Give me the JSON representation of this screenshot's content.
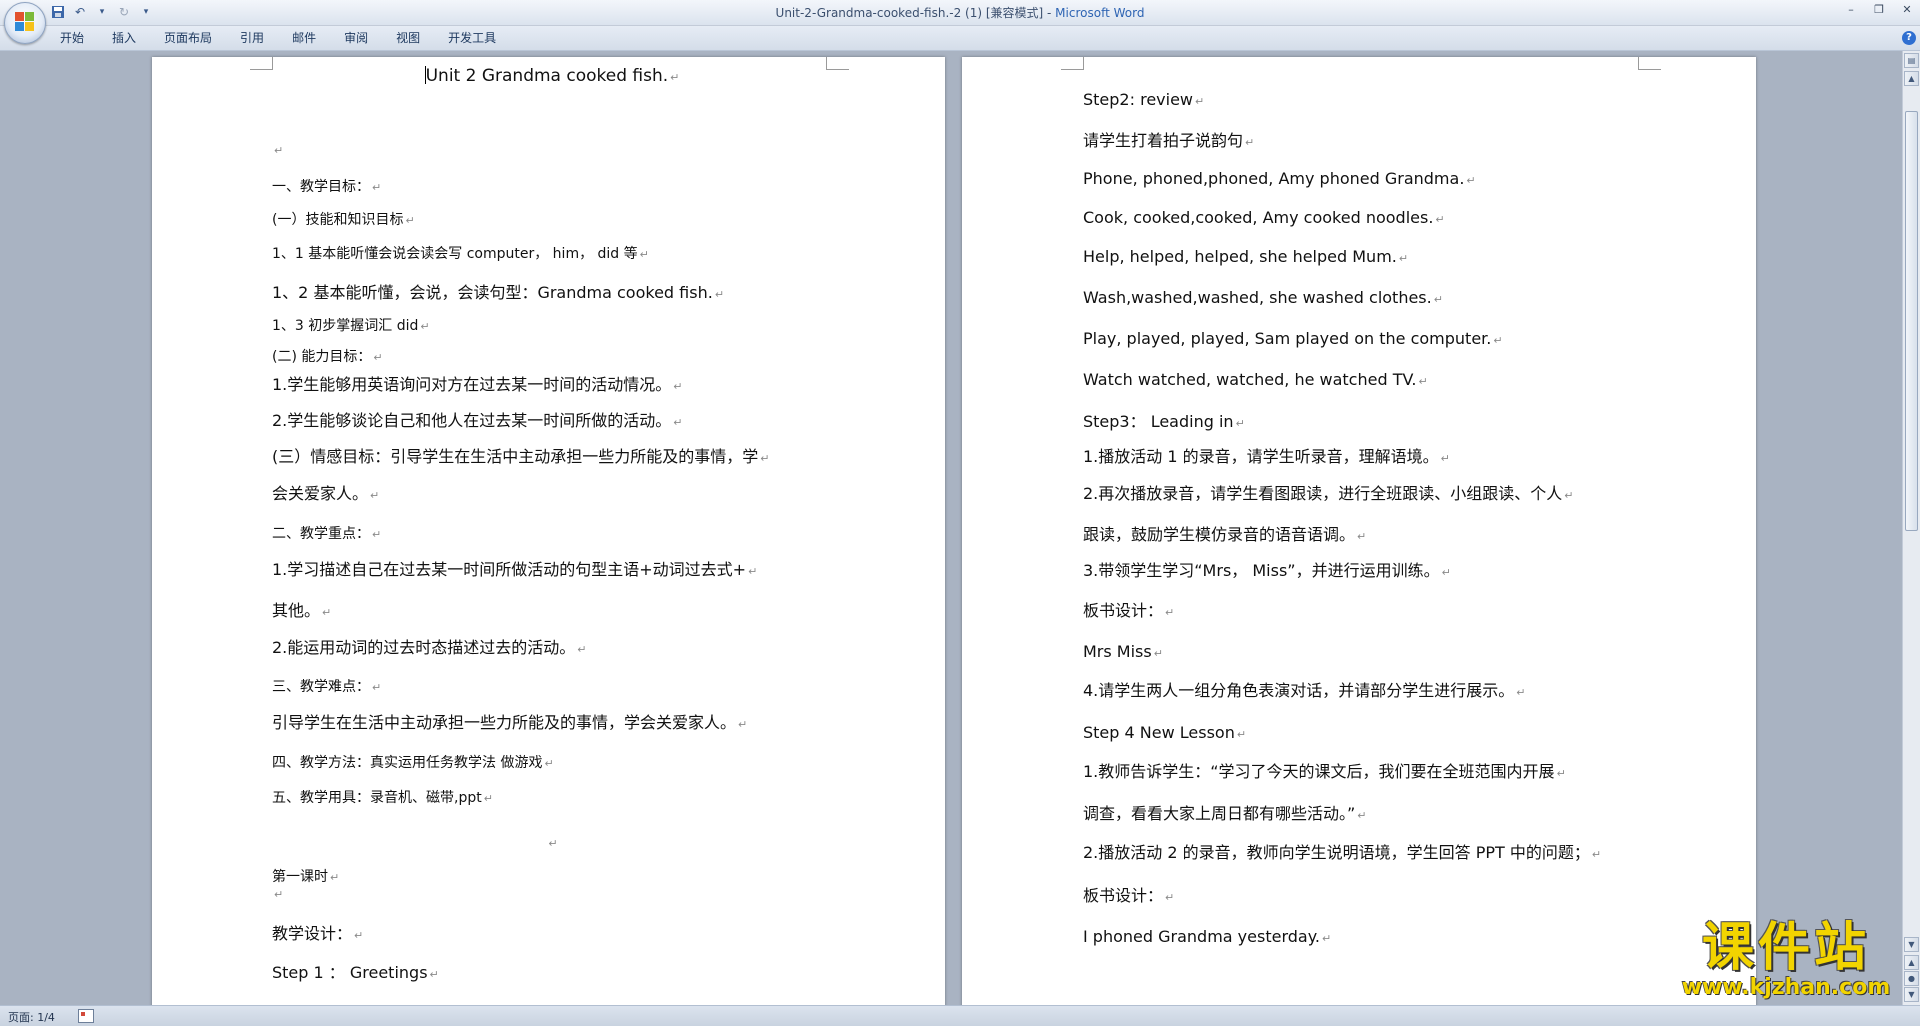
{
  "window": {
    "title": "Unit-2-Grandma-cooked-fish.-2 (1) [兼容模式] - ",
    "app_name": "Microsoft Word"
  },
  "ribbon": {
    "tabs": [
      "开始",
      "插入",
      "页面布局",
      "引用",
      "邮件",
      "审阅",
      "视图",
      "开发工具"
    ]
  },
  "status": {
    "page": "页面: 1/4"
  },
  "watermark": {
    "cn": "课件站",
    "url": "www.kjzhan.com"
  },
  "colors": {
    "accent": "#2e64b3",
    "watermark": "#f2d400",
    "workspace": "#a9b3c2"
  },
  "pilcrow": "↵",
  "left_page": {
    "title": "Unit 2 Grandma cooked fish.",
    "lines": [
      "",
      "一、教学目标：",
      "(一）技能和知识目标",
      "1、1 基本能听懂会说会读会写  computer，  him，  did  等",
      "1、2 基本能听懂，会说，会读句型：Grandma cooked fish.",
      "1、3 初步掌握词汇 did",
      "(二)     能力目标：",
      "1.学生能够用英语询问对方在过去某一时间的活动情况。",
      "2.学生能够谈论自己和他人在过去某一时间所做的活动。",
      "(三）情感目标：引导学生在生活中主动承担一些力所能及的事情，学",
      "会关爱家人。",
      "二、教学重点：",
      "1.学习描述自己在过去某一时间所做活动的句型主语+动词过去式+",
      "其他。",
      "2.能运用动词的过去时态描述过去的活动。",
      "三、教学难点：",
      "引导学生在生活中主动承担一些力所能及的事情，学会关爱家人。",
      "四、教学方法：真实运用任务教学法    做游戏",
      "五、教学用具：录音机、磁带,ppt",
      "",
      "第一课时",
      "",
      "教学设计：",
      "Step 1  ：  Greetings"
    ]
  },
  "right_page": {
    "lines": [
      "Step2: review",
      "请学生打着拍子说韵句",
      "Phone, phoned,phoned, Amy phoned Grandma.",
      "Cook, cooked,cooked, Amy cooked noodles.",
      "Help, helped, helped, she helped Mum.",
      "Wash,washed,washed, she washed clothes.",
      "Play, played, played, Sam played on the computer.",
      "Watch watched, watched, he watched TV.",
      "Step3：  Leading in",
      "1.播放活动 1 的录音，请学生听录音，理解语境。",
      "2.再次播放录音，请学生看图跟读，进行全班跟读、小组跟读、个人",
      "跟读，鼓励学生模仿录音的语音语调。",
      "3.带领学生学习“Mrs，  Miss”，并进行运用训练。",
      "板书设计：",
      "Mrs         Miss",
      "4.请学生两人一组分角色表演对话，并请部分学生进行展示。",
      "Step 4     New Lesson",
      "1.教师告诉学生：“学习了今天的课文后，我们要在全班范围内开展",
      "调查，看看大家上周日都有哪些活动。”",
      "2.播放活动 2 的录音，教师向学生说明语境，学生回答 PPT 中的问题；",
      "板书设计：",
      "I phoned Grandma yesterday."
    ]
  }
}
